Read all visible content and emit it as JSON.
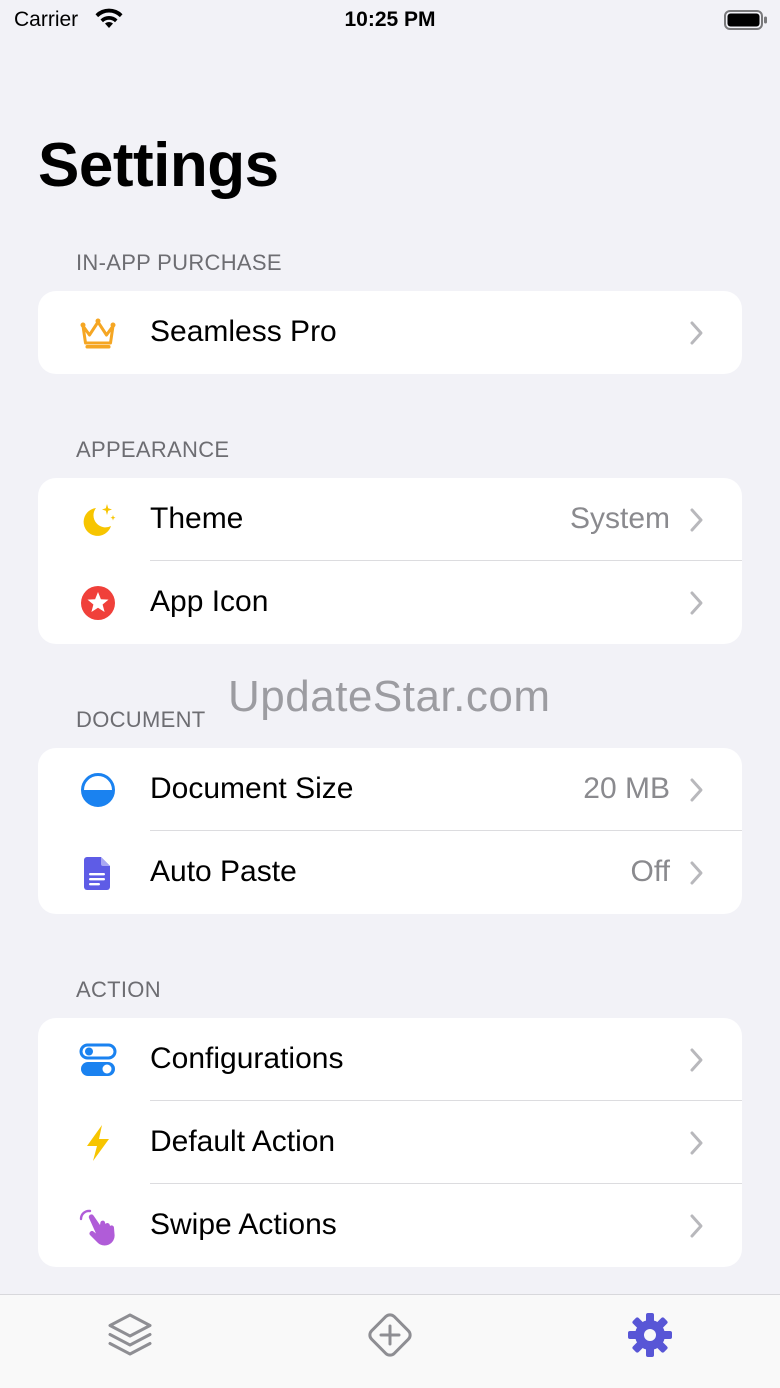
{
  "status_bar": {
    "carrier": "Carrier",
    "time": "10:25 PM"
  },
  "title": "Settings",
  "sections": {
    "iap": {
      "header": "IN-APP PURCHASE",
      "items": [
        {
          "label": "Seamless Pro",
          "value": ""
        }
      ]
    },
    "appearance": {
      "header": "APPEARANCE",
      "items": [
        {
          "label": "Theme",
          "value": "System"
        },
        {
          "label": "App Icon",
          "value": ""
        }
      ]
    },
    "document": {
      "header": "DOCUMENT",
      "items": [
        {
          "label": "Document Size",
          "value": "20 MB"
        },
        {
          "label": "Auto Paste",
          "value": "Off"
        }
      ]
    },
    "action": {
      "header": "ACTION",
      "items": [
        {
          "label": "Configurations",
          "value": ""
        },
        {
          "label": "Default Action",
          "value": ""
        },
        {
          "label": "Swipe Actions",
          "value": ""
        }
      ]
    }
  },
  "watermark": "UpdateStar.com",
  "icons": {
    "seamless_pro": "crown-icon",
    "theme": "moon-stars-icon",
    "app_icon": "star-circle-icon",
    "document_size": "half-circle-icon",
    "auto_paste": "document-icon",
    "configurations": "toggles-icon",
    "default_action": "bolt-icon",
    "swipe_actions": "hand-swipe-icon",
    "tab_layers": "layers-icon",
    "tab_add": "add-diamond-icon",
    "tab_settings": "gear-icon"
  },
  "colors": {
    "background": "#f2f2f7",
    "crown": "#f5a623",
    "moon": "#f7c500",
    "star_badge": "#f0403a",
    "half_circle": "#1a82f0",
    "document": "#5e5ce6",
    "toggles": "#1a82f0",
    "bolt": "#f7c500",
    "hand": "#b05cd8",
    "tab_active": "#5856d6",
    "tab_inactive": "#8e8e93"
  }
}
